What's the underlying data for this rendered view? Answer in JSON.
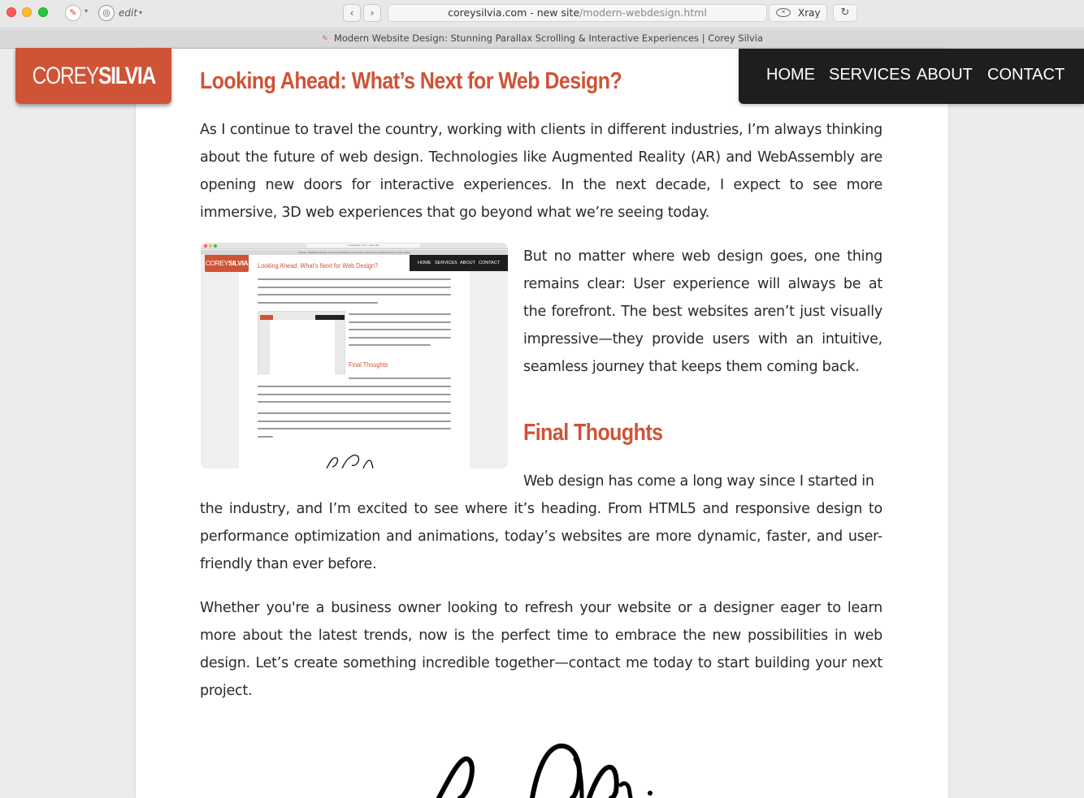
{
  "browser": {
    "address_domain": "coreysilvia.com - new site",
    "address_path": "/modern-webdesign.html",
    "edit_label": "edit",
    "xray_label": "Xray",
    "tab_title": "Modern Website Design: Stunning Parallax Scrolling & Interactive Experiences | Corey Silvia"
  },
  "site": {
    "logo_first": "COREY",
    "logo_last": "SILVIA",
    "nav": [
      "HOME",
      "SERVICES",
      "ABOUT",
      "CONTACT"
    ]
  },
  "article": {
    "heading_1": "Looking Ahead: What’s Next for Web Design?",
    "para_1": "As I continue to travel the country, working with clients in different industries, I’m always thinking about the future of web design. Technologies like Augmented Reality (AR) and WebAssembly are opening new doors for interactive experiences. In the next decade, I expect to see more immersive, 3D web experiences that go beyond what we’re seeing today.",
    "para_2": "But no matter where web design goes, one thing remains clear: User experience will always be at the forefront. The best websites aren’t just visually impressive—they provide users with an intuitive, seamless journey that keeps them coming back.",
    "heading_2": "Final Thoughts",
    "para_3_start": "Web design has come a long way since I started in",
    "para_3_rest": "the industry, and I’m excited to see where it’s heading. From HTML5 and responsive design to performance optimization and animations, today’s websites are more dynamic, faster, and user-friendly than ever before.",
    "para_4": "Whether you're a business owner looking to refresh your website or a designer eager to learn more about the latest trends, now is the perfect time to embrace the new possibilities in web design. Let’s create something incredible together—contact me today to start building your next project."
  },
  "thumbnail": {
    "logo_first": "COREY",
    "logo_last": "SILVIA",
    "heading_1": "Looking Ahead: What’s Next for Web Design?",
    "heading_2": "Final Thoughts",
    "nav": [
      "HOME",
      "SERVICES",
      "ABOUT",
      "CONTACT"
    ]
  },
  "colors": {
    "accent": "#cf5336",
    "nav_bg": "#1e1e1e",
    "text": "#2a2a2a"
  },
  "icons": [
    "back-arrow-icon",
    "forward-arrow-icon",
    "xray-eye-icon",
    "reload-icon",
    "extension-icon",
    "target-icon",
    "signature-graphic"
  ]
}
